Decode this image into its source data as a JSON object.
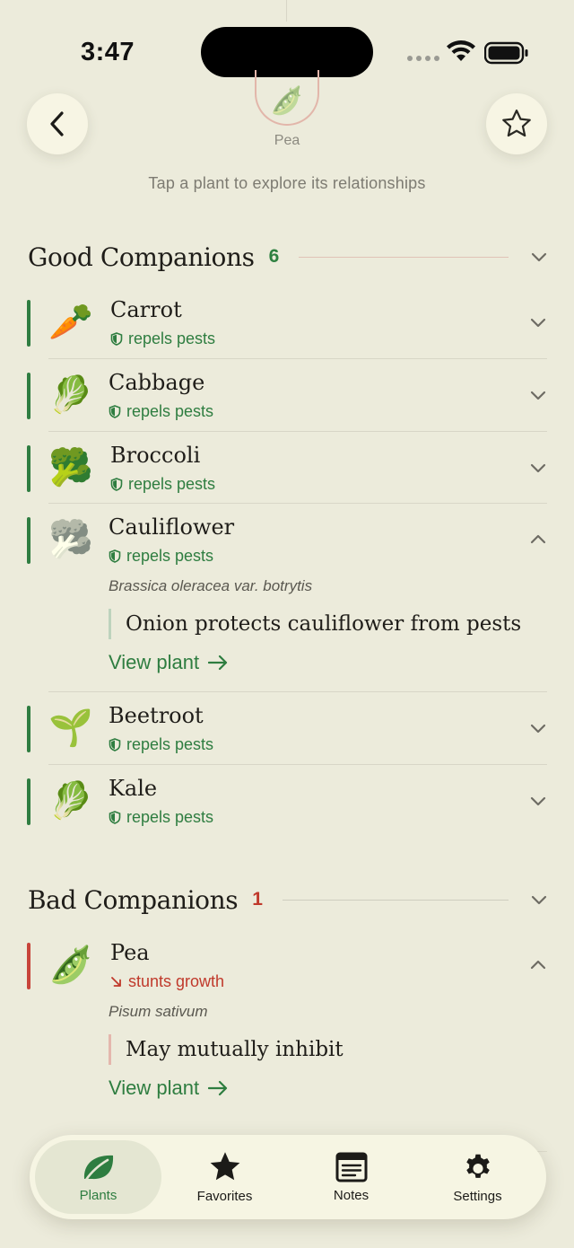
{
  "status_bar": {
    "time": "3:47"
  },
  "header": {
    "hub_plant": "Pea",
    "hub_emoji": "🫛",
    "hint": "Tap a plant to explore its relationships"
  },
  "good_companions": {
    "title": "Good Companions",
    "count": "6",
    "items": [
      {
        "name": "Carrot",
        "emoji": "🥕",
        "relation": "repels pests",
        "expanded": false
      },
      {
        "name": "Cabbage",
        "emoji": "🥬",
        "relation": "repels pests",
        "expanded": false
      },
      {
        "name": "Broccoli",
        "emoji": "🥦",
        "relation": "repels pests",
        "expanded": false
      },
      {
        "name": "Cauliflower",
        "emoji": "🥦",
        "relation": "repels pests",
        "expanded": true,
        "scientific_name": "Brassica oleracea var. botrytis",
        "note": "Onion protects cauliflower from pests",
        "link": "View plant"
      },
      {
        "name": "Beetroot",
        "emoji": "🌱",
        "relation": "repels pests",
        "expanded": false
      },
      {
        "name": "Kale",
        "emoji": "🥬",
        "relation": "repels pests",
        "expanded": false
      }
    ]
  },
  "bad_companions": {
    "title": "Bad Companions",
    "count": "1",
    "items": [
      {
        "name": "Pea",
        "emoji": "🫛",
        "relation": "stunts growth",
        "expanded": true,
        "scientific_name": "Pisum sativum",
        "note": "May mutually inhibit",
        "link": "View plant"
      }
    ]
  },
  "tab_bar": {
    "active": "Plants",
    "tabs": [
      {
        "label": "Plants",
        "icon": "leaf-icon"
      },
      {
        "label": "Favorites",
        "icon": "star-icon"
      },
      {
        "label": "Notes",
        "icon": "notes-icon"
      },
      {
        "label": "Settings",
        "icon": "gear-icon"
      }
    ]
  },
  "colors": {
    "background": "#ecebdb",
    "good_accent": "#2e7d40",
    "bad_accent": "#c0392b",
    "card": "#f6f5e3"
  }
}
